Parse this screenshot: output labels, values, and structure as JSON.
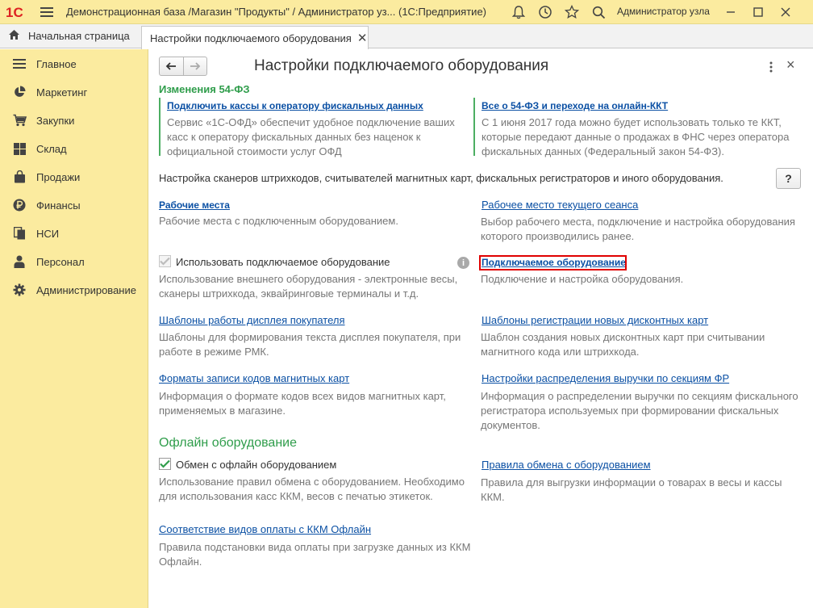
{
  "window": {
    "title": "Демонстрационная база /Магазин \"Продукты\" / Администратор уз...  (1С:Предприятие)",
    "user": "Администратор узла",
    "logo_text": "1С"
  },
  "tabs": {
    "home_label": "Начальная страница",
    "active_label": "Настройки подключаемого оборудования",
    "close_glyph": "✕"
  },
  "sidebar": {
    "items": [
      {
        "label": "Главное",
        "icon": "menu-lines-icon"
      },
      {
        "label": "Маркетинг",
        "icon": "pie-chart-icon"
      },
      {
        "label": "Закупки",
        "icon": "cart-icon"
      },
      {
        "label": "Склад",
        "icon": "grid-icon"
      },
      {
        "label": "Продажи",
        "icon": "bag-icon"
      },
      {
        "label": "Финансы",
        "icon": "ruble-coin-icon"
      },
      {
        "label": "НСИ",
        "icon": "documents-icon"
      },
      {
        "label": "Персонал",
        "icon": "person-icon"
      },
      {
        "label": "Администрирование",
        "icon": "gear-icon"
      }
    ]
  },
  "page": {
    "title": "Настройки подключаемого оборудования",
    "close_glyph": "×",
    "help_label": "?"
  },
  "fz54": {
    "heading": "Изменения 54-ФЗ",
    "left_link": "Подключить кассы к оператору фискальных данных",
    "left_desc": "Сервис «1С-ОФД» обеспечит удобное подключение ваших касс к оператору фискальных данных без наценок к официальной стоимости услуг ОФД",
    "right_link": "Все о 54-ФЗ и переходе на онлайн-ККТ",
    "right_desc": "С 1 июня 2017 года можно будет использовать только те ККТ, которые передают данные о продажах в ФНС через оператора фискальных данных (Федеральный закон 54-ФЗ)."
  },
  "intro_text": "Настройка сканеров штрихкодов, считывателей магнитных карт, фискальных регистраторов и иного оборудования.",
  "settings": {
    "workplaces_link": "Рабочие места",
    "workplaces_desc": "Рабочие места с подключенным оборудованием.",
    "current_workplace_link": "Рабочее место текущего сеанса",
    "current_workplace_desc": "Выбор рабочего места, подключение и настройка оборудования которого производились ранее.",
    "use_equipment_label": "Использовать подключаемое оборудование",
    "use_equipment_checked": true,
    "use_equipment_desc": "Использование внешнего оборудования - электронные весы, сканеры штрихкода, эквайринговые терминалы и т.д.",
    "info_glyph": "i",
    "equipment_link": "Подключаемое оборудование",
    "equipment_desc": "Подключение и настройка оборудования.",
    "display_templates_link": "Шаблоны работы дисплея покупателя",
    "display_templates_desc": "Шаблоны для формирования текста дисплея покупателя, при работе в режиме РМК.",
    "discount_templates_link": "Шаблоны регистрации новых дисконтных карт",
    "discount_templates_desc": "Шаблон создания новых дисконтных карт при считывании магнитного кода или штрихкода.",
    "magcard_formats_link": "Форматы записи кодов магнитных карт",
    "magcard_formats_desc": "Информация о формате кодов всех видов магнитных карт, применяемых в магазине.",
    "revenue_sections_link": "Настройки распределения выручки по секциям ФР",
    "revenue_sections_desc": "Информация о распределении выручки по секциям фискального регистратора используемых при формировании фискальных документов."
  },
  "offline": {
    "heading": "Офлайн оборудование",
    "exchange_label": "Обмен с офлайн оборудованием",
    "exchange_checked": true,
    "exchange_desc": "Использование правил обмена с оборудованием. Необходимо для использования касс ККМ, весов с печатью этикеток.",
    "rules_link": "Правила обмена с оборудованием",
    "rules_desc": "Правила для выгрузки информации о товарах в весы и кассы ККМ.",
    "payment_types_link": "Соответствие видов оплаты с ККМ Офлайн",
    "payment_types_desc": "Правила подстановки вида оплаты при загрузке данных из ККМ Офлайн."
  },
  "colors": {
    "yellow_panel": "#fbeb9f",
    "green_heading": "#2f9d4b",
    "link_blue": "#0b50a4",
    "highlight_red": "#e00000"
  }
}
